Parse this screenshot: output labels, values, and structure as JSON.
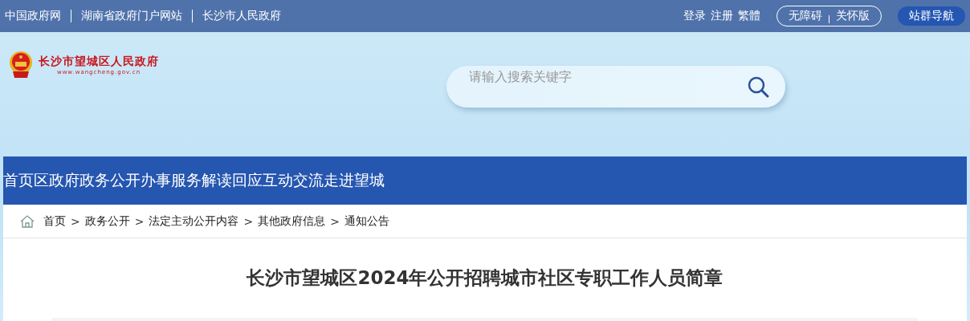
{
  "top_bar": {
    "site_links": [
      "中国政府网",
      "湖南省政府门户网站",
      "长沙市人民政府"
    ],
    "user_links": [
      "登录",
      "注册",
      "繁體"
    ],
    "mode_buttons": [
      "无障碍",
      "关怀版"
    ],
    "nav_button": "站群导航"
  },
  "header": {
    "logo_title": "长沙市望城区人民政府",
    "logo_url": "www.wangcheng.gov.cn",
    "search": {
      "placeholder": "请输入搜索关键字"
    }
  },
  "nav": {
    "items": [
      "首页",
      "区政府",
      "政务公开",
      "办事服务",
      "解读回应",
      "互动交流",
      "走进望城"
    ]
  },
  "breadcrumb": {
    "separator": ">",
    "items": [
      "首页",
      "政务公开",
      "法定主动公开内容",
      "其他政府信息",
      "通知公告"
    ]
  },
  "article": {
    "title": "长沙市望城区2024年公开招聘城市社区专职工作人员简章"
  }
}
